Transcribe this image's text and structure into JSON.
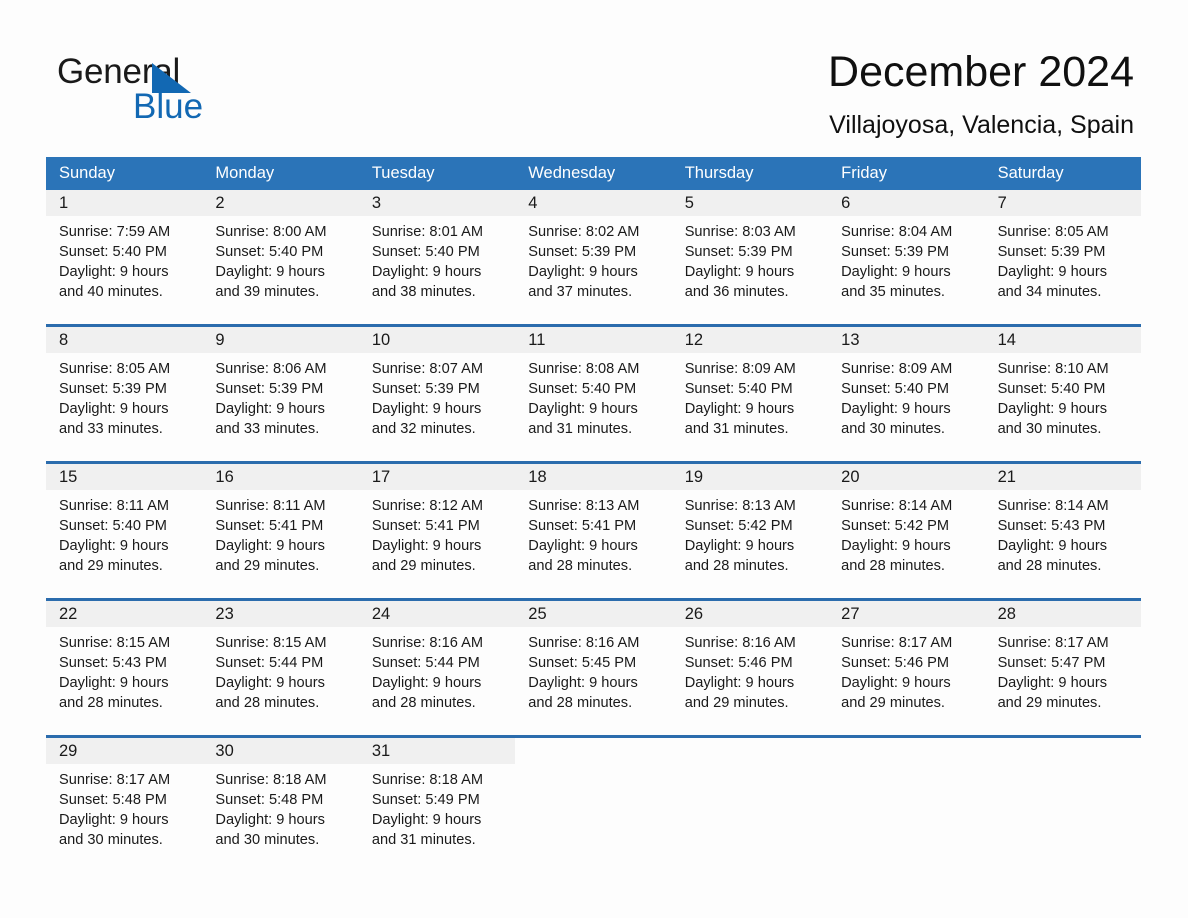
{
  "brand": {
    "name_part1": "General",
    "name_part2": "Blue",
    "triangle_color": "#1268b3",
    "text_color": "#1a1a1a"
  },
  "header": {
    "title": "December 2024",
    "location": "Villajoyosa, Valencia, Spain"
  },
  "theme": {
    "header_bg": "#2b74b8",
    "week_rule": "#2b6cad",
    "daynum_bg": "#f0f0f0",
    "page_bg": "#fdfdfd",
    "text": "#1a1a1a"
  },
  "weekdays": [
    "Sunday",
    "Monday",
    "Tuesday",
    "Wednesday",
    "Thursday",
    "Friday",
    "Saturday"
  ],
  "weeks": [
    {
      "days": [
        {
          "num": "1",
          "sunrise": "Sunrise: 7:59 AM",
          "sunset": "Sunset: 5:40 PM",
          "daylight1": "Daylight: 9 hours",
          "daylight2": "and 40 minutes."
        },
        {
          "num": "2",
          "sunrise": "Sunrise: 8:00 AM",
          "sunset": "Sunset: 5:40 PM",
          "daylight1": "Daylight: 9 hours",
          "daylight2": "and 39 minutes."
        },
        {
          "num": "3",
          "sunrise": "Sunrise: 8:01 AM",
          "sunset": "Sunset: 5:40 PM",
          "daylight1": "Daylight: 9 hours",
          "daylight2": "and 38 minutes."
        },
        {
          "num": "4",
          "sunrise": "Sunrise: 8:02 AM",
          "sunset": "Sunset: 5:39 PM",
          "daylight1": "Daylight: 9 hours",
          "daylight2": "and 37 minutes."
        },
        {
          "num": "5",
          "sunrise": "Sunrise: 8:03 AM",
          "sunset": "Sunset: 5:39 PM",
          "daylight1": "Daylight: 9 hours",
          "daylight2": "and 36 minutes."
        },
        {
          "num": "6",
          "sunrise": "Sunrise: 8:04 AM",
          "sunset": "Sunset: 5:39 PM",
          "daylight1": "Daylight: 9 hours",
          "daylight2": "and 35 minutes."
        },
        {
          "num": "7",
          "sunrise": "Sunrise: 8:05 AM",
          "sunset": "Sunset: 5:39 PM",
          "daylight1": "Daylight: 9 hours",
          "daylight2": "and 34 minutes."
        }
      ]
    },
    {
      "days": [
        {
          "num": "8",
          "sunrise": "Sunrise: 8:05 AM",
          "sunset": "Sunset: 5:39 PM",
          "daylight1": "Daylight: 9 hours",
          "daylight2": "and 33 minutes."
        },
        {
          "num": "9",
          "sunrise": "Sunrise: 8:06 AM",
          "sunset": "Sunset: 5:39 PM",
          "daylight1": "Daylight: 9 hours",
          "daylight2": "and 33 minutes."
        },
        {
          "num": "10",
          "sunrise": "Sunrise: 8:07 AM",
          "sunset": "Sunset: 5:39 PM",
          "daylight1": "Daylight: 9 hours",
          "daylight2": "and 32 minutes."
        },
        {
          "num": "11",
          "sunrise": "Sunrise: 8:08 AM",
          "sunset": "Sunset: 5:40 PM",
          "daylight1": "Daylight: 9 hours",
          "daylight2": "and 31 minutes."
        },
        {
          "num": "12",
          "sunrise": "Sunrise: 8:09 AM",
          "sunset": "Sunset: 5:40 PM",
          "daylight1": "Daylight: 9 hours",
          "daylight2": "and 31 minutes."
        },
        {
          "num": "13",
          "sunrise": "Sunrise: 8:09 AM",
          "sunset": "Sunset: 5:40 PM",
          "daylight1": "Daylight: 9 hours",
          "daylight2": "and 30 minutes."
        },
        {
          "num": "14",
          "sunrise": "Sunrise: 8:10 AM",
          "sunset": "Sunset: 5:40 PM",
          "daylight1": "Daylight: 9 hours",
          "daylight2": "and 30 minutes."
        }
      ]
    },
    {
      "days": [
        {
          "num": "15",
          "sunrise": "Sunrise: 8:11 AM",
          "sunset": "Sunset: 5:40 PM",
          "daylight1": "Daylight: 9 hours",
          "daylight2": "and 29 minutes."
        },
        {
          "num": "16",
          "sunrise": "Sunrise: 8:11 AM",
          "sunset": "Sunset: 5:41 PM",
          "daylight1": "Daylight: 9 hours",
          "daylight2": "and 29 minutes."
        },
        {
          "num": "17",
          "sunrise": "Sunrise: 8:12 AM",
          "sunset": "Sunset: 5:41 PM",
          "daylight1": "Daylight: 9 hours",
          "daylight2": "and 29 minutes."
        },
        {
          "num": "18",
          "sunrise": "Sunrise: 8:13 AM",
          "sunset": "Sunset: 5:41 PM",
          "daylight1": "Daylight: 9 hours",
          "daylight2": "and 28 minutes."
        },
        {
          "num": "19",
          "sunrise": "Sunrise: 8:13 AM",
          "sunset": "Sunset: 5:42 PM",
          "daylight1": "Daylight: 9 hours",
          "daylight2": "and 28 minutes."
        },
        {
          "num": "20",
          "sunrise": "Sunrise: 8:14 AM",
          "sunset": "Sunset: 5:42 PM",
          "daylight1": "Daylight: 9 hours",
          "daylight2": "and 28 minutes."
        },
        {
          "num": "21",
          "sunrise": "Sunrise: 8:14 AM",
          "sunset": "Sunset: 5:43 PM",
          "daylight1": "Daylight: 9 hours",
          "daylight2": "and 28 minutes."
        }
      ]
    },
    {
      "days": [
        {
          "num": "22",
          "sunrise": "Sunrise: 8:15 AM",
          "sunset": "Sunset: 5:43 PM",
          "daylight1": "Daylight: 9 hours",
          "daylight2": "and 28 minutes."
        },
        {
          "num": "23",
          "sunrise": "Sunrise: 8:15 AM",
          "sunset": "Sunset: 5:44 PM",
          "daylight1": "Daylight: 9 hours",
          "daylight2": "and 28 minutes."
        },
        {
          "num": "24",
          "sunrise": "Sunrise: 8:16 AM",
          "sunset": "Sunset: 5:44 PM",
          "daylight1": "Daylight: 9 hours",
          "daylight2": "and 28 minutes."
        },
        {
          "num": "25",
          "sunrise": "Sunrise: 8:16 AM",
          "sunset": "Sunset: 5:45 PM",
          "daylight1": "Daylight: 9 hours",
          "daylight2": "and 28 minutes."
        },
        {
          "num": "26",
          "sunrise": "Sunrise: 8:16 AM",
          "sunset": "Sunset: 5:46 PM",
          "daylight1": "Daylight: 9 hours",
          "daylight2": "and 29 minutes."
        },
        {
          "num": "27",
          "sunrise": "Sunrise: 8:17 AM",
          "sunset": "Sunset: 5:46 PM",
          "daylight1": "Daylight: 9 hours",
          "daylight2": "and 29 minutes."
        },
        {
          "num": "28",
          "sunrise": "Sunrise: 8:17 AM",
          "sunset": "Sunset: 5:47 PM",
          "daylight1": "Daylight: 9 hours",
          "daylight2": "and 29 minutes."
        }
      ]
    },
    {
      "days": [
        {
          "num": "29",
          "sunrise": "Sunrise: 8:17 AM",
          "sunset": "Sunset: 5:48 PM",
          "daylight1": "Daylight: 9 hours",
          "daylight2": "and 30 minutes."
        },
        {
          "num": "30",
          "sunrise": "Sunrise: 8:18 AM",
          "sunset": "Sunset: 5:48 PM",
          "daylight1": "Daylight: 9 hours",
          "daylight2": "and 30 minutes."
        },
        {
          "num": "31",
          "sunrise": "Sunrise: 8:18 AM",
          "sunset": "Sunset: 5:49 PM",
          "daylight1": "Daylight: 9 hours",
          "daylight2": "and 31 minutes."
        },
        {
          "num": "",
          "sunrise": "",
          "sunset": "",
          "daylight1": "",
          "daylight2": ""
        },
        {
          "num": "",
          "sunrise": "",
          "sunset": "",
          "daylight1": "",
          "daylight2": ""
        },
        {
          "num": "",
          "sunrise": "",
          "sunset": "",
          "daylight1": "",
          "daylight2": ""
        },
        {
          "num": "",
          "sunrise": "",
          "sunset": "",
          "daylight1": "",
          "daylight2": ""
        }
      ]
    }
  ]
}
